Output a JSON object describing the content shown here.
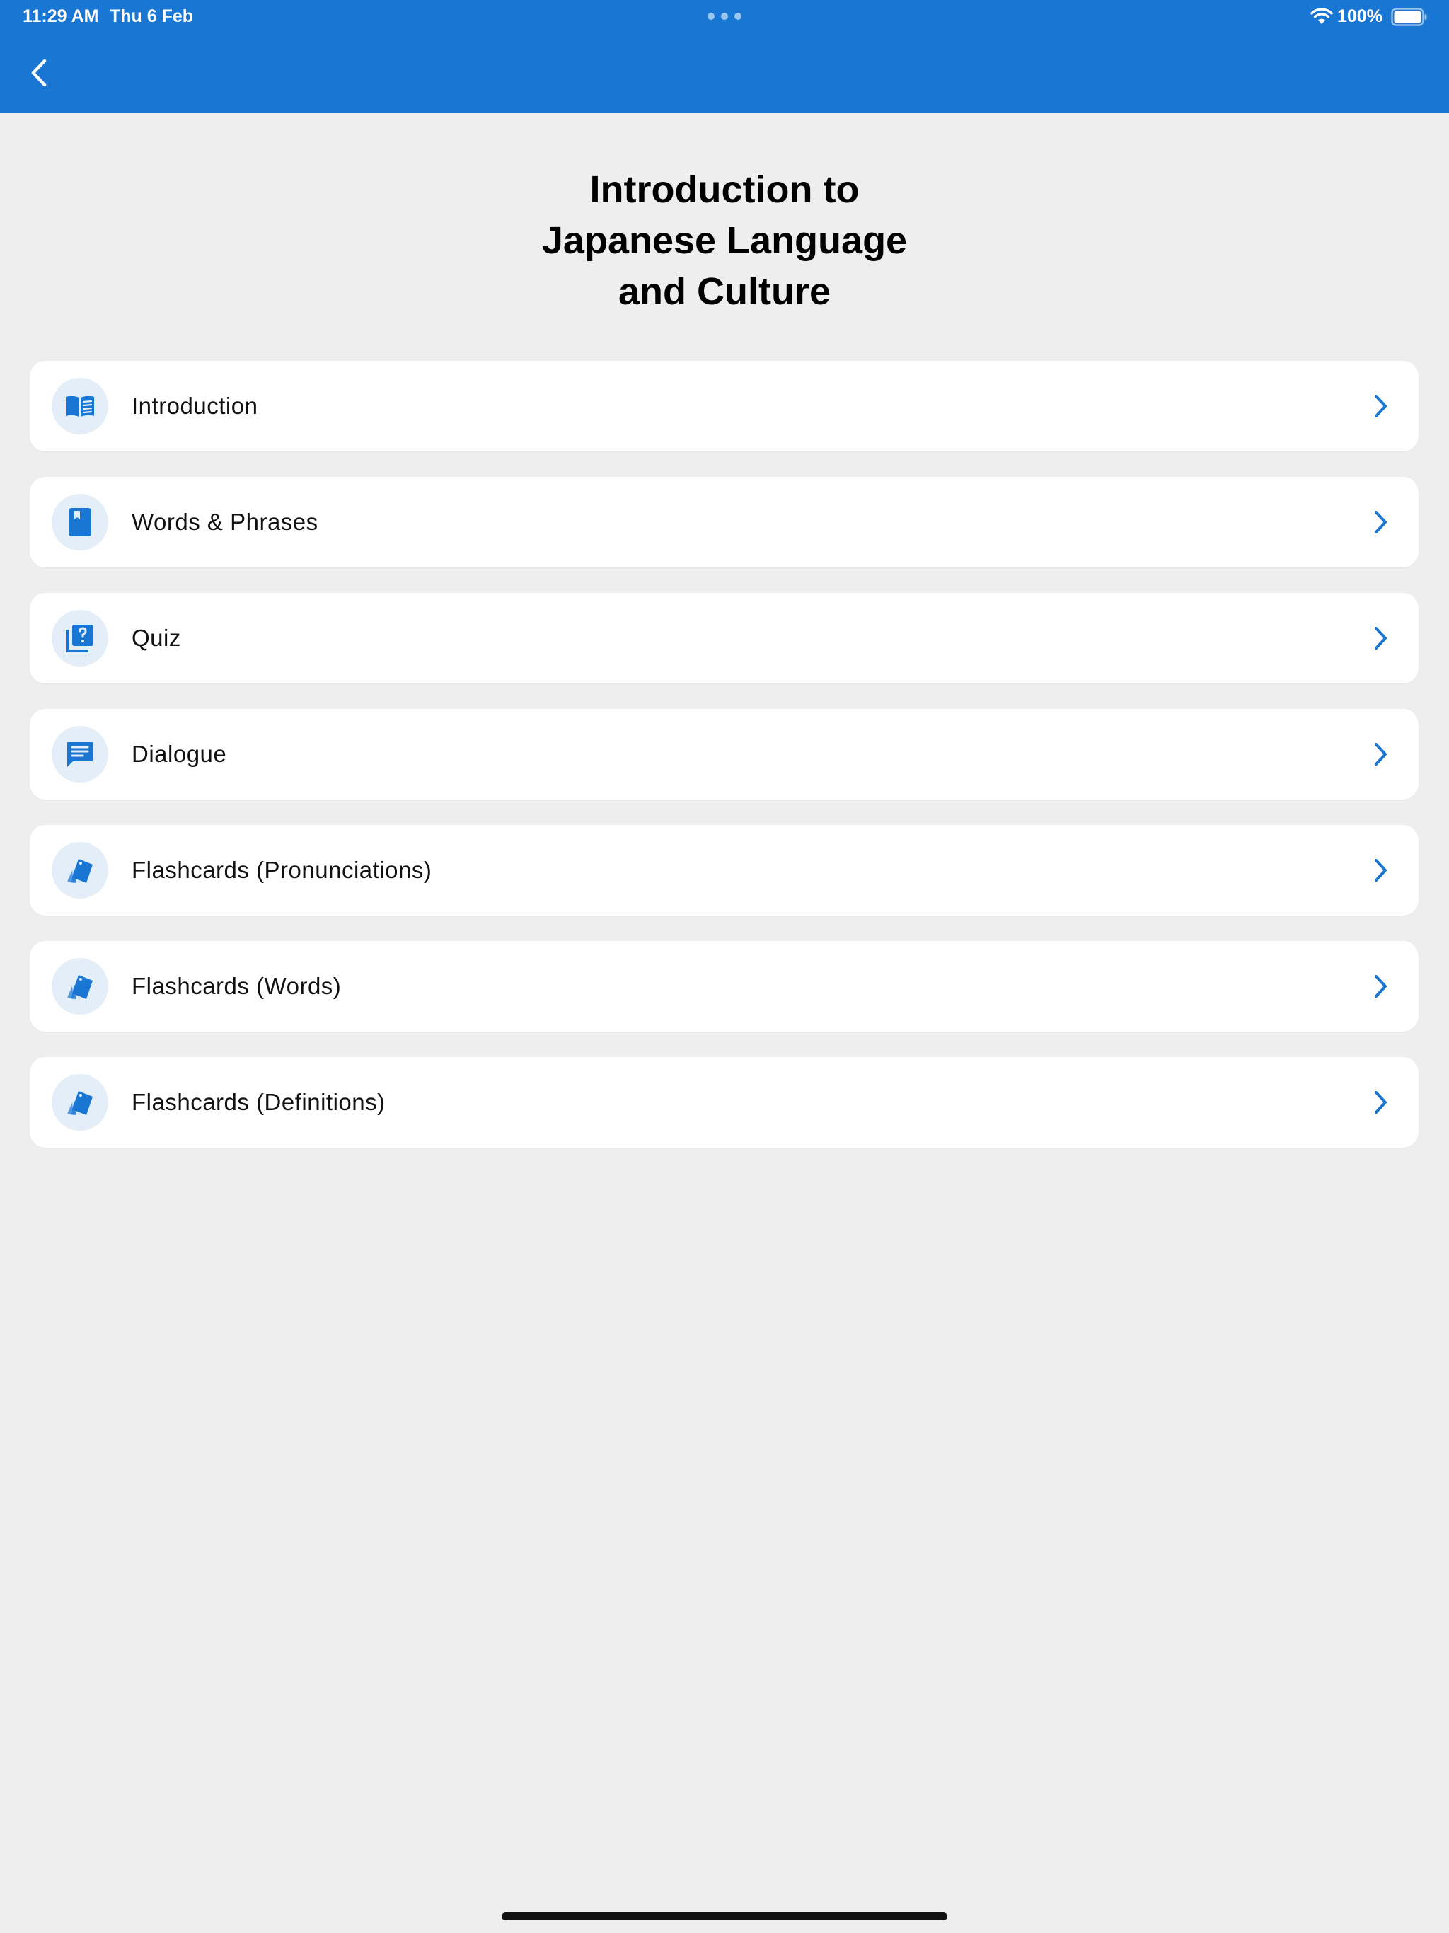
{
  "status_bar": {
    "time": "11:29 AM",
    "date": "Thu 6 Feb",
    "battery": "100%"
  },
  "header": {
    "back_icon": "chevron-left-icon"
  },
  "title": "Introduction to\nJapanese Language\nand Culture",
  "menu": {
    "items": [
      {
        "label": "Introduction",
        "icon": "open-book-icon"
      },
      {
        "label": "Words & Phrases",
        "icon": "bookmark-book-icon"
      },
      {
        "label": "Quiz",
        "icon": "question-book-icon"
      },
      {
        "label": "Dialogue",
        "icon": "chat-bubble-icon"
      },
      {
        "label": "Flashcards (Pronunciations)",
        "icon": "flashcards-icon"
      },
      {
        "label": "Flashcards (Words)",
        "icon": "flashcards-icon"
      },
      {
        "label": "Flashcards (Definitions)",
        "icon": "flashcards-icon"
      }
    ]
  },
  "colors": {
    "accent": "#1976d3",
    "background": "#eeeeee",
    "icon_circle": "#e4eef9"
  }
}
